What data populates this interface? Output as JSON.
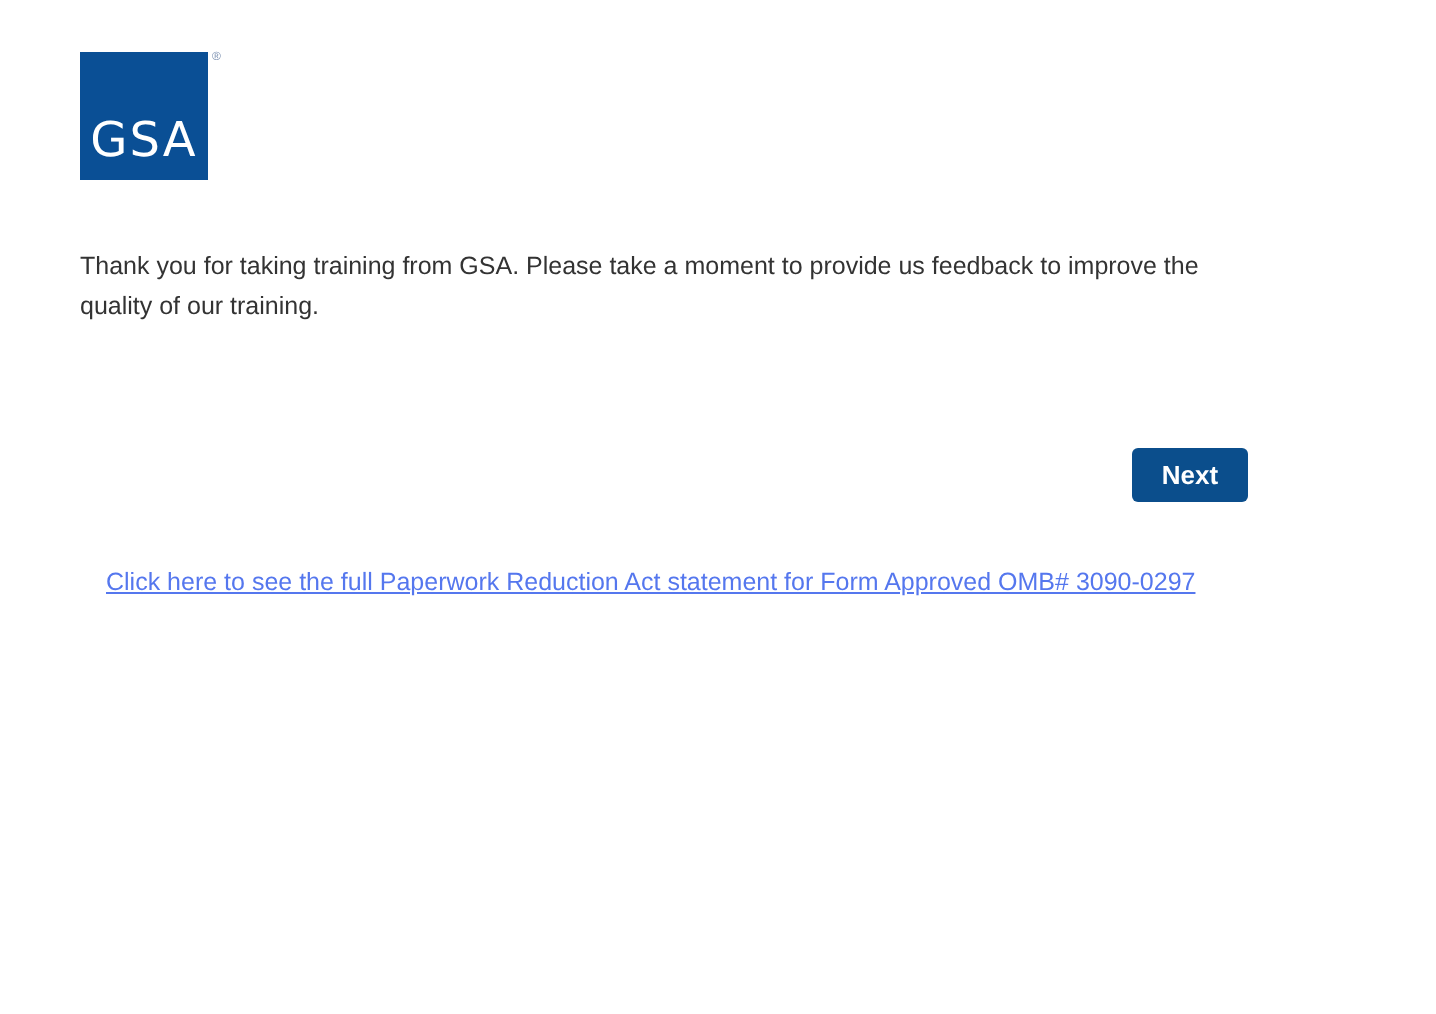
{
  "logo": {
    "text": "GSA",
    "mark": "®"
  },
  "intro": "Thank you for taking training from GSA. Please take a moment to provide us feedback to improve the quality of our training.",
  "buttons": [
    "Next"
  ],
  "link": "Click here to see the full Paperwork Reduction Act statement for Form Approved OMB# 3090-0297"
}
